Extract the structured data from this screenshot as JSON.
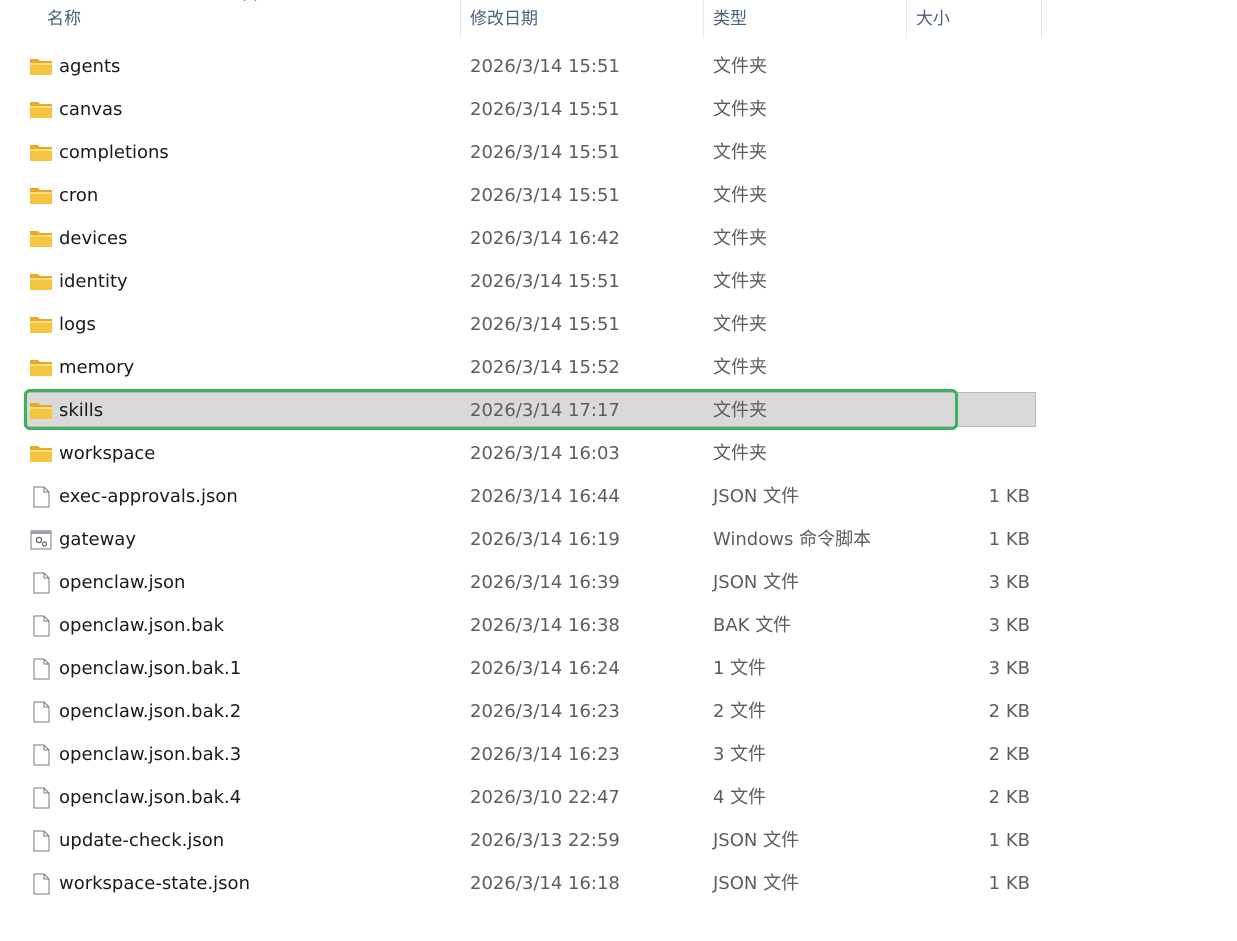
{
  "header": {
    "name_label": "名称",
    "date_label": "修改日期",
    "type_label": "类型",
    "size_label": "大小"
  },
  "files": [
    {
      "name": "agents",
      "date": "2026/3/14 15:51",
      "type": "文件夹",
      "size": "",
      "icon": "folder-icon",
      "selected": false
    },
    {
      "name": "canvas",
      "date": "2026/3/14 15:51",
      "type": "文件夹",
      "size": "",
      "icon": "folder-icon",
      "selected": false
    },
    {
      "name": "completions",
      "date": "2026/3/14 15:51",
      "type": "文件夹",
      "size": "",
      "icon": "folder-icon",
      "selected": false
    },
    {
      "name": "cron",
      "date": "2026/3/14 15:51",
      "type": "文件夹",
      "size": "",
      "icon": "folder-icon",
      "selected": false
    },
    {
      "name": "devices",
      "date": "2026/3/14 16:42",
      "type": "文件夹",
      "size": "",
      "icon": "folder-icon",
      "selected": false
    },
    {
      "name": "identity",
      "date": "2026/3/14 15:51",
      "type": "文件夹",
      "size": "",
      "icon": "folder-icon",
      "selected": false
    },
    {
      "name": "logs",
      "date": "2026/3/14 15:51",
      "type": "文件夹",
      "size": "",
      "icon": "folder-icon",
      "selected": false
    },
    {
      "name": "memory",
      "date": "2026/3/14 15:52",
      "type": "文件夹",
      "size": "",
      "icon": "folder-icon",
      "selected": false
    },
    {
      "name": "skills",
      "date": "2026/3/14 17:17",
      "type": "文件夹",
      "size": "",
      "icon": "folder-icon",
      "selected": true
    },
    {
      "name": "workspace",
      "date": "2026/3/14 16:03",
      "type": "文件夹",
      "size": "",
      "icon": "folder-icon",
      "selected": false
    },
    {
      "name": "exec-approvals.json",
      "date": "2026/3/14 16:44",
      "type": "JSON 文件",
      "size": "1 KB",
      "icon": "file-icon",
      "selected": false
    },
    {
      "name": "gateway",
      "date": "2026/3/14 16:19",
      "type": "Windows 命令脚本",
      "size": "1 KB",
      "icon": "script-icon",
      "selected": false
    },
    {
      "name": "openclaw.json",
      "date": "2026/3/14 16:39",
      "type": "JSON 文件",
      "size": "3 KB",
      "icon": "file-icon",
      "selected": false
    },
    {
      "name": "openclaw.json.bak",
      "date": "2026/3/14 16:38",
      "type": "BAK 文件",
      "size": "3 KB",
      "icon": "file-icon",
      "selected": false
    },
    {
      "name": "openclaw.json.bak.1",
      "date": "2026/3/14 16:24",
      "type": "1 文件",
      "size": "3 KB",
      "icon": "file-icon",
      "selected": false
    },
    {
      "name": "openclaw.json.bak.2",
      "date": "2026/3/14 16:23",
      "type": "2 文件",
      "size": "2 KB",
      "icon": "file-icon",
      "selected": false
    },
    {
      "name": "openclaw.json.bak.3",
      "date": "2026/3/14 16:23",
      "type": "3 文件",
      "size": "2 KB",
      "icon": "file-icon",
      "selected": false
    },
    {
      "name": "openclaw.json.bak.4",
      "date": "2026/3/10 22:47",
      "type": "4 文件",
      "size": "2 KB",
      "icon": "file-icon",
      "selected": false
    },
    {
      "name": "update-check.json",
      "date": "2026/3/13 22:59",
      "type": "JSON 文件",
      "size": "1 KB",
      "icon": "file-icon",
      "selected": false
    },
    {
      "name": "workspace-state.json",
      "date": "2026/3/14 16:18",
      "type": "JSON 文件",
      "size": "1 KB",
      "icon": "file-icon",
      "selected": false
    }
  ],
  "colors": {
    "selection_bg": "#d9d9d9",
    "highlight_outline": "#3bb35d",
    "folder": "#f5c542",
    "header_text": "#4c607a"
  }
}
